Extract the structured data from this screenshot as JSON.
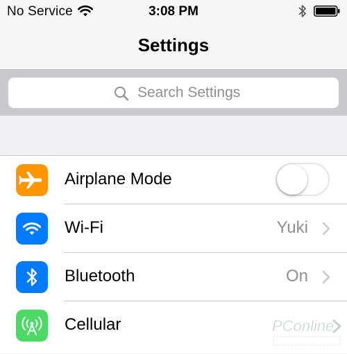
{
  "status_bar": {
    "carrier": "No Service",
    "time": "3:08 PM",
    "wifi_icon": "wifi-icon",
    "bluetooth_icon": "bluetooth-icon",
    "battery_icon": "battery-icon",
    "battery_level": 1.0
  },
  "nav": {
    "title": "Settings"
  },
  "search": {
    "placeholder": "Search Settings",
    "icon": "search-icon"
  },
  "rows": [
    {
      "label": "Airplane Mode",
      "icon": "airplane-icon",
      "icon_color": "#ff9500",
      "control": "toggle",
      "on": false
    },
    {
      "label": "Wi-Fi",
      "icon": "wifi-icon",
      "icon_color": "#007aff",
      "value": "Yuki"
    },
    {
      "label": "Bluetooth",
      "icon": "bluetooth-icon",
      "icon_color": "#007aff",
      "value": "On"
    },
    {
      "label": "Cellular",
      "icon": "cellular-antenna-icon",
      "icon_color": "#4cd964"
    }
  ],
  "watermark": {
    "logo": "pconline-logo"
  }
}
